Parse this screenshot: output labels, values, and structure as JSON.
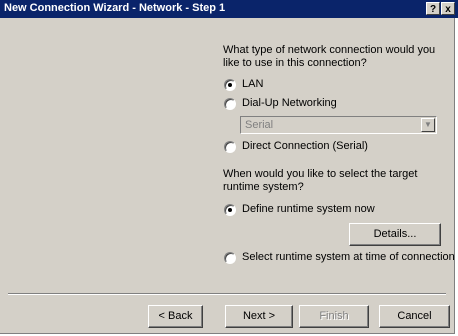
{
  "window": {
    "title": "New Connection Wizard - Network - Step 1",
    "help_button": "?",
    "close_button": "x"
  },
  "question1": {
    "line1": "What type of network connection would you",
    "line2": "like to use in this connection?"
  },
  "options": {
    "lan": {
      "label": "LAN",
      "selected": true
    },
    "dialup": {
      "label": "Dial-Up Networking",
      "selected": false
    },
    "direct": {
      "label": "Direct Connection (Serial)",
      "selected": false
    }
  },
  "dialup_combo": {
    "value": "Serial",
    "enabled": false
  },
  "question2": {
    "line1": "When would you like to select the target",
    "line2": "runtime system?"
  },
  "runtime": {
    "define_now": {
      "label": "Define runtime system now",
      "selected": true
    },
    "at_connect": {
      "label": "Select runtime system at time of connection",
      "selected": false
    },
    "details_label": "Details..."
  },
  "footer": {
    "back_label": "< Back",
    "next_label": "Next >",
    "finish_label": "Finish",
    "cancel_label": "Cancel"
  }
}
